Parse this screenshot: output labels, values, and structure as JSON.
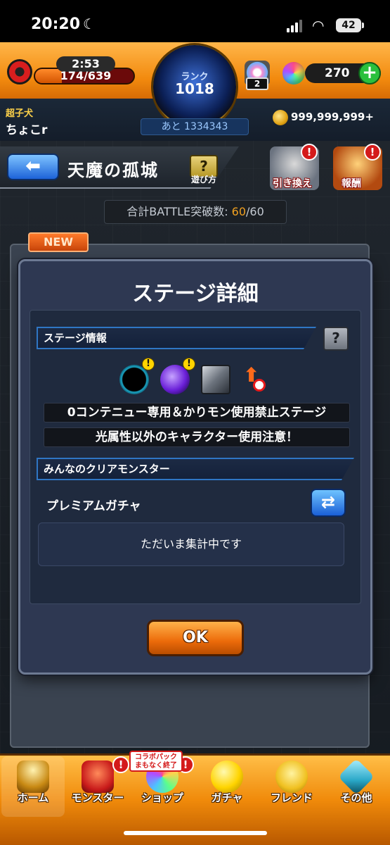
{
  "status_bar": {
    "time": "20:20",
    "battery": "42"
  },
  "header": {
    "timer": "2:53",
    "stamina": "174/639",
    "stamina_fraction": 0.272,
    "rank_label": "ランク",
    "rank_value": "1018",
    "rank_next": "あと 1334343",
    "lamp_count": "2",
    "orbs": "270",
    "user_title": "超子犬",
    "user_name": "ちょこr",
    "coins": "999,999,999+"
  },
  "stage": {
    "back_arrow": "⬅",
    "title": "天魔の孤城",
    "help_icon": "?",
    "help_label": "遊び方",
    "exchange_label": "引き換え",
    "reward_label": "報酬",
    "battle_prefix": "合計BATTLE突破数: ",
    "battle_current": "60",
    "battle_total": "/60",
    "new_tag": "NEW"
  },
  "dialog": {
    "title": "ステージ詳細",
    "section_info": "ステージ情報",
    "info_icon": "?",
    "rule_1": "0コンテニュー専用＆かりモン使用禁止ステージ",
    "rule_2": "光属性以外のキャラクター使用注意！",
    "section_clear": "みんなのクリアモンスター",
    "clear_source": "プレミアムガチャ",
    "aggregating": "ただいま集計中です",
    "ok_label": "OK",
    "gimmick_icons": [
      "black-hole-icon",
      "purple-orb-icon",
      "block-icon",
      "no-speed-up-icon"
    ]
  },
  "bottom_nav": {
    "items": [
      {
        "label": "ホーム",
        "icon": "home-icon"
      },
      {
        "label": "モンスター",
        "icon": "monster-icon"
      },
      {
        "label": "ショップ",
        "icon": "shop-icon"
      },
      {
        "label": "ガチャ",
        "icon": "gacha-icon"
      },
      {
        "label": "フレンド",
        "icon": "friend-icon"
      },
      {
        "label": "その他",
        "icon": "other-icon"
      }
    ],
    "collab_line1": "コラボパック",
    "collab_line2": "まもなく終了"
  }
}
